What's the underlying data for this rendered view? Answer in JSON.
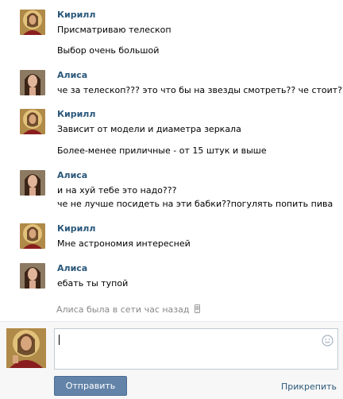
{
  "colors": {
    "author": "#2b587a",
    "status": "#888888",
    "button": "#6383a8",
    "link": "#2b587a"
  },
  "messages": [
    {
      "author": "Кирилл",
      "avatar": "jesus-icon",
      "lines": [
        "Присматриваю телескоп",
        "Выбор очень большой"
      ]
    },
    {
      "author": "Алиса",
      "avatar": "girl-icon",
      "lines": [
        "че за телескоп??? это что бы на звезды смотреть?? че стоит??"
      ]
    },
    {
      "author": "Кирилл",
      "avatar": "jesus-icon",
      "lines": [
        "Зависит от модели и диаметра зеркала",
        "Более-менее приличные - от 15 штук и выше"
      ]
    },
    {
      "author": "Алиса",
      "avatar": "girl-icon",
      "lines": [
        "и на хуй тебе это надо???",
        "че не лучше посидеть на эти бабки??погулять попить пива"
      ]
    },
    {
      "author": "Кирилл",
      "avatar": "jesus-icon",
      "lines": [
        "Мне астрономия интересней"
      ]
    },
    {
      "author": "Алиса",
      "avatar": "girl-icon",
      "lines": [
        "ебать ты тупой"
      ]
    }
  ],
  "status": {
    "text": "Алиса была в сети час назад",
    "icon": "mobile-phone-icon"
  },
  "composer": {
    "value": "",
    "send_label": "Отправить",
    "attach_label": "Прикрепить",
    "emoji_icon": "smile-icon"
  }
}
